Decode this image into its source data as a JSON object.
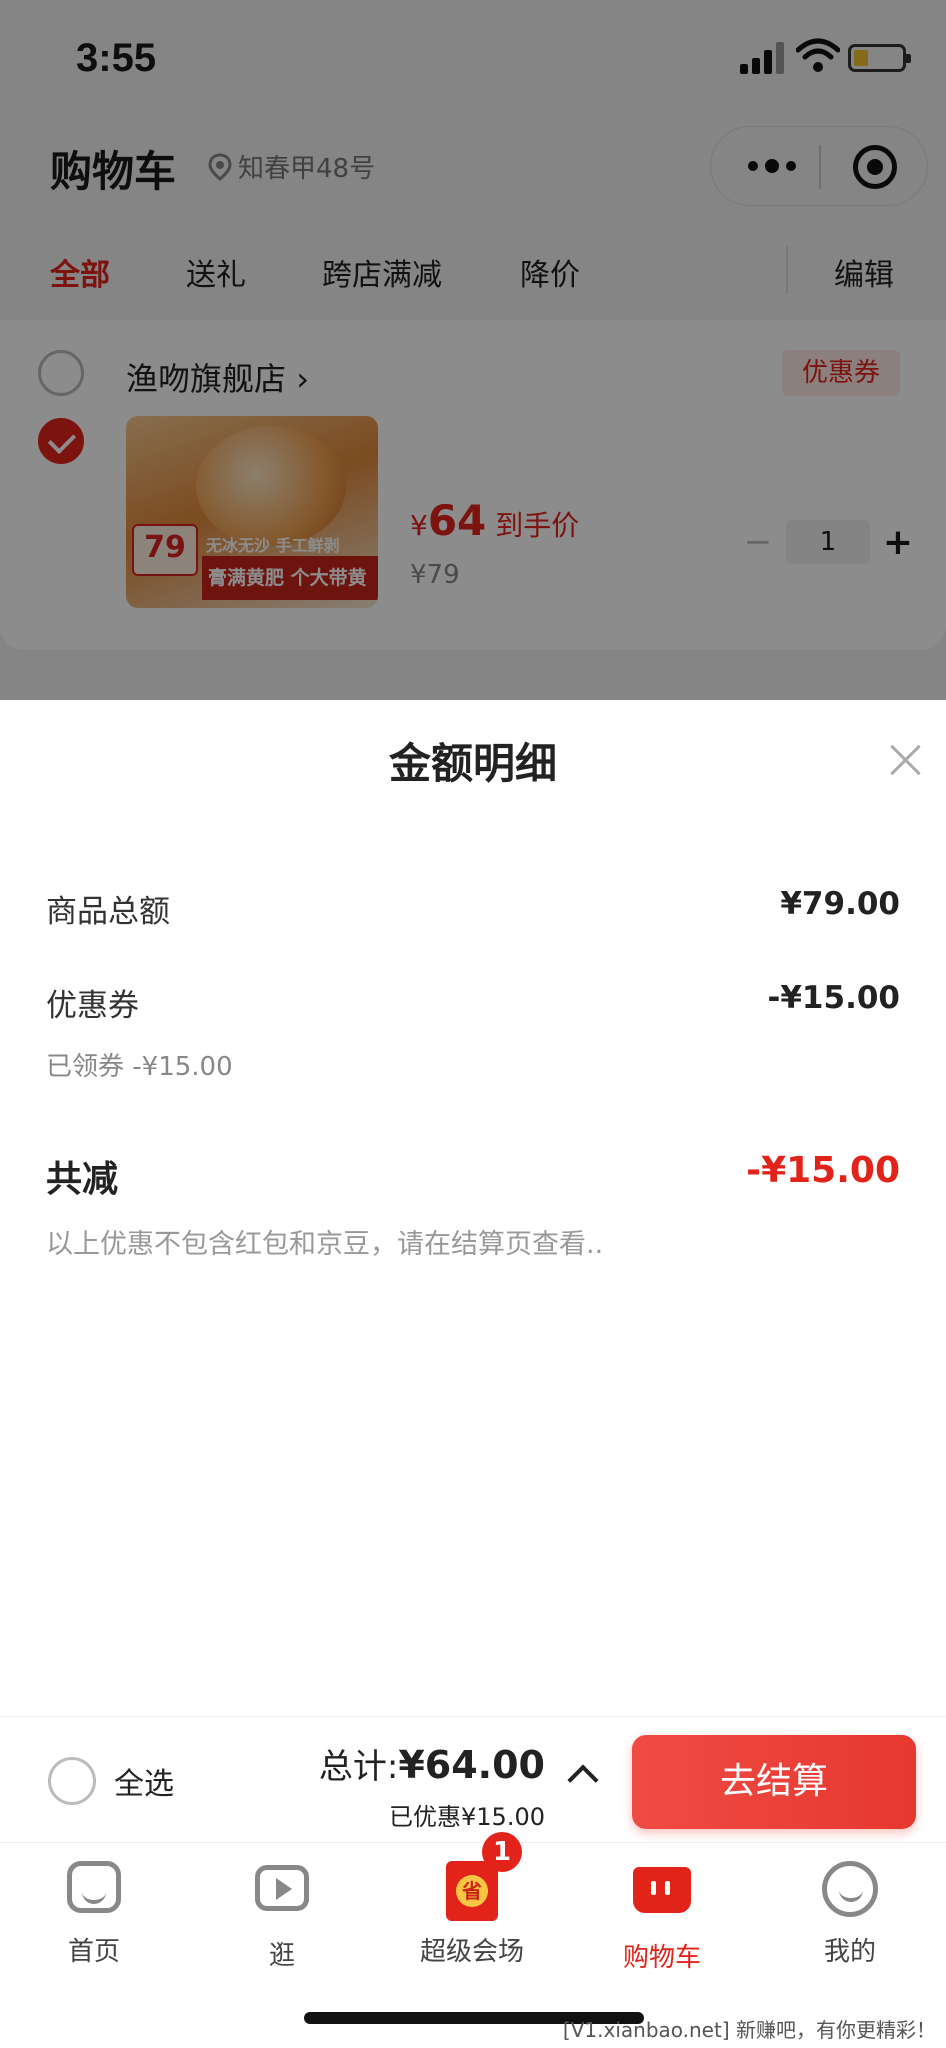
{
  "status_bar": {
    "time": "3:55"
  },
  "header": {
    "title": "购物车",
    "location": "知春甲48号"
  },
  "tabs": [
    {
      "label": "全部",
      "active": true
    },
    {
      "label": "送礼",
      "active": false
    },
    {
      "label": "跨店满减",
      "active": false
    },
    {
      "label": "降价",
      "active": false
    }
  ],
  "edit_label": "编辑",
  "store": {
    "name": "渔吻旗舰店",
    "coupon_tag": "优惠券",
    "product": {
      "image_badge": "79",
      "image_text_1": "无冰无沙 手工鲜剥",
      "image_text_2": "膏满黄肥 个大带黄",
      "price_currency": "¥",
      "price_now": "64",
      "price_suffix": "到手价",
      "price_orig": "¥79",
      "quantity": "1"
    }
  },
  "sheet": {
    "title": "金额明细",
    "rows": {
      "goods_total_label": "商品总额",
      "goods_total_value": "¥79.00",
      "coupon_label": "优惠券",
      "coupon_value": "-¥15.00",
      "coupon_sub": "已领券 -¥15.00"
    },
    "total_reduce_label": "共减",
    "total_reduce_value": "-¥15.00",
    "note": "以上优惠不包含红包和京豆，请在结算页查看.."
  },
  "checkout": {
    "select_all": "全选",
    "total_prefix": "总计:",
    "total_value": "¥64.00",
    "saved": "已优惠¥15.00",
    "pay_button": "去结算"
  },
  "tabbar": [
    {
      "label": "首页",
      "icon": "home-icon"
    },
    {
      "label": "逛",
      "icon": "video-icon"
    },
    {
      "label": "超级会场",
      "icon": "venue-icon",
      "badge": "1"
    },
    {
      "label": "购物车",
      "icon": "cart-icon",
      "active": true
    },
    {
      "label": "我的",
      "icon": "profile-icon"
    }
  ],
  "watermark": "[V1.xianbao.net] 新赚吧，有你更精彩！",
  "colors": {
    "accent": "#e2231a",
    "overlay": "rgba(0,0,0,0.45)"
  }
}
